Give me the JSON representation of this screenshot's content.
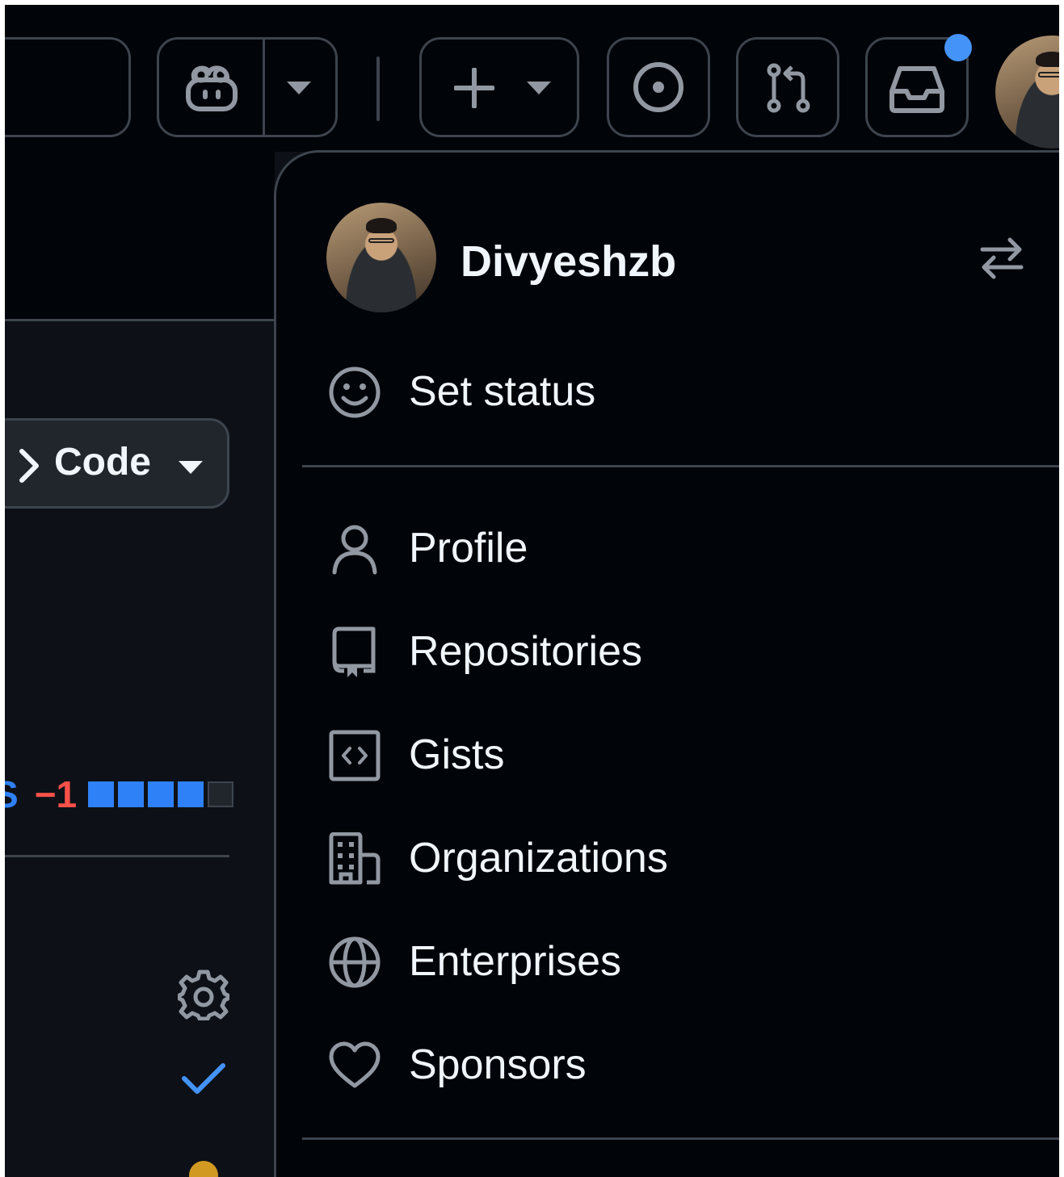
{
  "header": {
    "notification_color": "#4493f8"
  },
  "repo_page": {
    "code_button_label": "Code",
    "diff_prefix": "S",
    "diff_deleted": "−1",
    "diff_blocks": [
      "blue",
      "blue",
      "blue",
      "blue",
      "gray"
    ],
    "colors": {
      "added": "#2f81f7",
      "deleted": "#f85149",
      "neutral": "#21262d"
    }
  },
  "user_menu": {
    "username": "Divyeshzb",
    "set_status_label": "Set status",
    "items": [
      {
        "label": "Profile",
        "icon": "person-icon"
      },
      {
        "label": "Repositories",
        "icon": "repo-icon"
      },
      {
        "label": "Gists",
        "icon": "code-square-icon"
      },
      {
        "label": "Organizations",
        "icon": "organization-icon"
      },
      {
        "label": "Enterprises",
        "icon": "globe-icon"
      },
      {
        "label": "Sponsors",
        "icon": "heart-icon"
      }
    ]
  }
}
